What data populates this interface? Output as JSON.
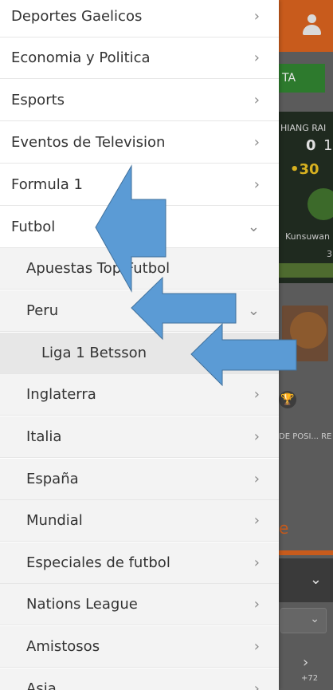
{
  "menu": {
    "items": [
      {
        "label": "Deportes Gaelicos",
        "chevron": "›",
        "level": 0
      },
      {
        "label": "Economia y Politica",
        "chevron": "›",
        "level": 0
      },
      {
        "label": "Esports",
        "chevron": "›",
        "level": 0
      },
      {
        "label": "Eventos de Television",
        "chevron": "›",
        "level": 0
      },
      {
        "label": "Formula 1",
        "chevron": "›",
        "level": 0
      },
      {
        "label": "Futbol",
        "chevron": "⌄",
        "level": 0
      },
      {
        "label": "Apuestas Top Futbol",
        "chevron": "",
        "level": 1
      },
      {
        "label": "Peru",
        "chevron": "⌄",
        "level": 1
      },
      {
        "label": "Liga 1 Betsson",
        "chevron": "",
        "level": 2
      },
      {
        "label": "Inglaterra",
        "chevron": "›",
        "level": 1
      },
      {
        "label": "Italia",
        "chevron": "›",
        "level": 1
      },
      {
        "label": "España",
        "chevron": "›",
        "level": 1
      },
      {
        "label": "Mundial",
        "chevron": "›",
        "level": 1
      },
      {
        "label": "Especiales de futbol",
        "chevron": "›",
        "level": 1
      },
      {
        "label": "Nations League",
        "chevron": "›",
        "level": 1
      },
      {
        "label": "Amistosos",
        "chevron": "›",
        "level": 1
      },
      {
        "label": "Asia",
        "chevron": "›",
        "level": 1
      }
    ]
  },
  "background": {
    "cta_text": "TA",
    "team_name": "HIANG RAI",
    "score_home": "0",
    "score_home_2": "1",
    "score_points": "•30",
    "player_name": "Kunsuwan",
    "tick_value": "3",
    "trophy_label": "DE POSI... RE",
    "partial_letter": "e",
    "more_count": "+72"
  },
  "colors": {
    "orange": "#c85b1c",
    "green_cta": "#2d7a2d",
    "arrow_blue": "#5b9bd5",
    "arrow_stroke": "#41719c"
  }
}
